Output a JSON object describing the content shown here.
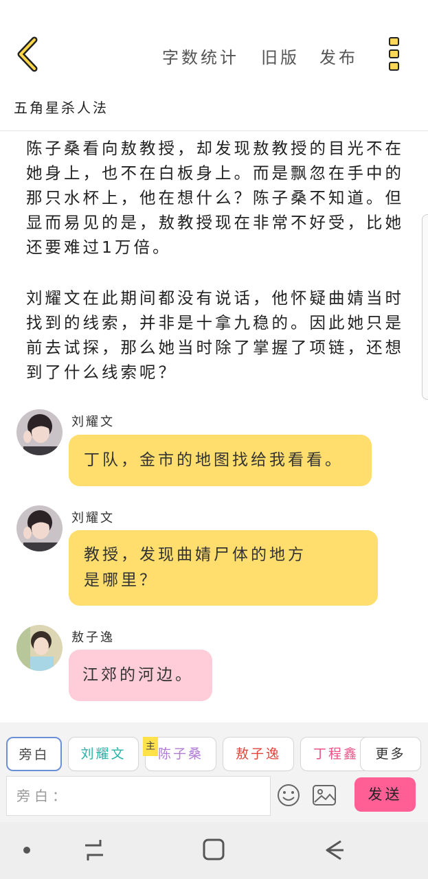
{
  "header": {
    "word_count_label": "字数统计",
    "old_version_label": "旧版",
    "publish_label": "发布",
    "back_icon": "chevron-left-icon",
    "more_icon": "more-vertical-icon"
  },
  "story": {
    "title": "五角星杀人法"
  },
  "narration": [
    "陈子桑看向敖教授，却发现敖教授的目光不在她身上，也不在白板身上。而是飘忽在手中的那只水杯上，他在想什么？陈子桑不知道。但显而易见的是，敖教授现在非常不好受，比她还要难过1万倍。",
    "刘耀文在此期间都没有说话，他怀疑曲婧当时找到的线索，并非是十拿九稳的。因此她只是前去试探，那么她当时除了掌握了项链，还想到了什么线索呢？"
  ],
  "messages": [
    {
      "name": "刘耀文",
      "text": "丁队，金市的地图找给我看看。",
      "color": "#ffde6e"
    },
    {
      "name": "刘耀文",
      "text_line1": "教授，发现曲婧尸体的地方",
      "text_line2": "是哪里？",
      "color": "#ffde6e"
    },
    {
      "name": "敖子逸",
      "text": "江郊的河边。",
      "color": "#ffcdd9"
    }
  ],
  "roles": [
    {
      "label": "旁白",
      "color": "#444444"
    },
    {
      "label": "刘耀文",
      "color": "#27b3a8"
    },
    {
      "label": "陈子桑",
      "color": "#b07ad6"
    },
    {
      "label": "敖子逸",
      "color": "#e0453a"
    },
    {
      "label": "丁程鑫",
      "color": "#ef4f86"
    },
    {
      "label": "更多",
      "color": "#333333"
    }
  ],
  "lead_badge": "主",
  "composer": {
    "placeholder": "旁白：",
    "send_label": "发送",
    "emoji_icon": "smiley-icon",
    "image_icon": "image-icon"
  },
  "colors": {
    "accent_yellow": "#ffde6e",
    "accent_pink": "#ffcdd9",
    "send_pink": "#ff5f95"
  }
}
